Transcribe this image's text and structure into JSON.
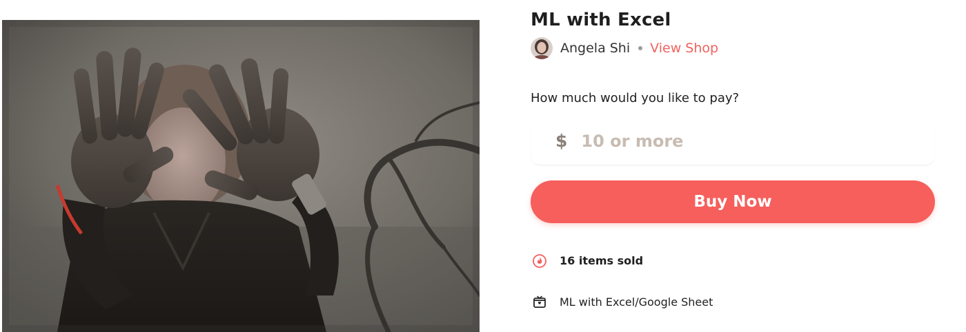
{
  "product": {
    "title": "ML with Excel",
    "image_icon": "photo-hands-raised"
  },
  "creator": {
    "name": "Angela Shi",
    "avatar_icon": "creator-avatar",
    "view_shop_label": "View Shop"
  },
  "pricing": {
    "question": "How much would you like to pay?",
    "currency_symbol": "$",
    "input_value": "",
    "input_placeholder": "10 or more"
  },
  "actions": {
    "buy_label": "Buy Now"
  },
  "meta": {
    "sold_icon": "flame-icon",
    "sold_text": "16 items sold",
    "file_icon": "package-icon",
    "file_text": "ML with Excel/Google Sheet"
  },
  "colors": {
    "accent": "#f65f5c",
    "link": "#f0625e",
    "text": "#1f1f1f"
  }
}
